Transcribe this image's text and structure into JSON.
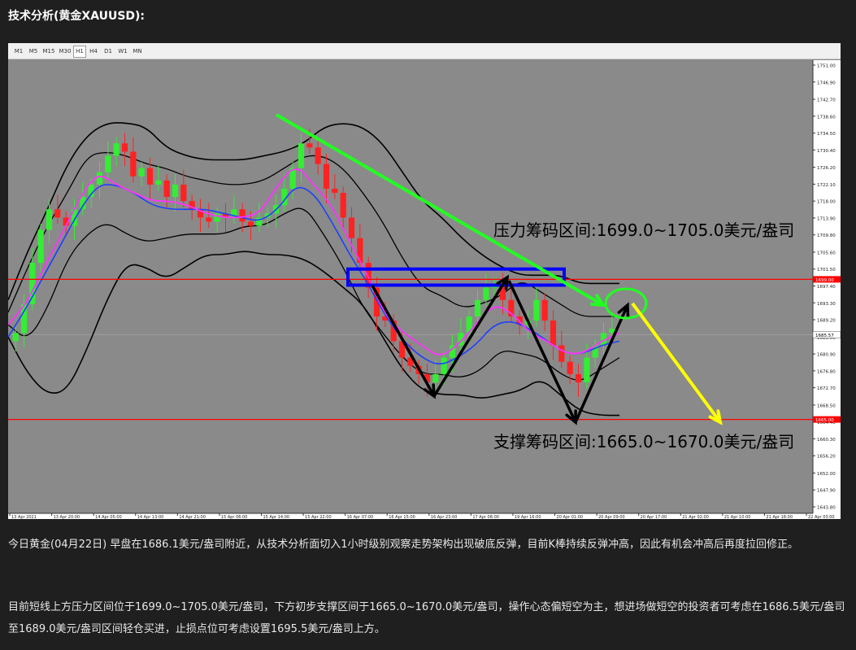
{
  "heading": "技术分析(黄金XAUUSD):",
  "timeframes": [
    "M1",
    "M5",
    "M15",
    "M30",
    "H1",
    "H4",
    "D1",
    "W1",
    "MN"
  ],
  "active_timeframe": "H1",
  "colors": {
    "background": "#1f1f1f",
    "chart_bg": "#8a8a8a",
    "bull_candle": "#33ee33",
    "bear_candle": "#ff2222",
    "ma_pink": "#ff33ff",
    "ma_blue": "#1f3fff",
    "bollinger": "#000000",
    "level_line": "#ff0000",
    "trend_green": "#22ff22",
    "forecast_yellow": "#ffff00",
    "zone_box": "#0000ff"
  },
  "chart_data": {
    "type": "candlestick",
    "symbol": "XAUUSD",
    "timeframe": "H1",
    "y_axis_ticks": [
      "1751.00",
      "1746.90",
      "1742.70",
      "1738.60",
      "1734.50",
      "1730.40",
      "1726.20",
      "1722.10",
      "1718.00",
      "1713.90",
      "1709.80",
      "1705.60",
      "1701.50",
      "1697.40",
      "1693.30",
      "1689.20",
      "1685.00",
      "1680.90",
      "1676.80",
      "1672.70",
      "1668.50",
      "1664.40",
      "1660.30",
      "1656.20",
      "1652.00",
      "1647.90",
      "1643.80"
    ],
    "ylim": [
      1643.8,
      1751.0
    ],
    "x_axis_labels": [
      "13 Apr 2021",
      "13 Apr 20:00",
      "14 Apr 05:00",
      "14 Apr 13:00",
      "14 Apr 21:00",
      "15 Apr 06:00",
      "15 Apr 14:00",
      "15 Apr 22:00",
      "16 Apr 07:00",
      "16 Apr 15:00",
      "16 Apr 23:00",
      "17 Apr 08:00",
      "19 Apr 16:00",
      "20 Apr 01:00",
      "20 Apr 09:00",
      "20 Apr 17:00",
      "21 Apr 02:00",
      "21 Apr 10:00",
      "21 Apr 18:00",
      "22 Apr 03:00"
    ],
    "current_price": "1685.57",
    "resistance_price": "1699.00",
    "support_price": "1665.00",
    "resistance_label": "压力筹码区间:1699.0~1705.0美元/盎司",
    "support_label": "支撑筹码区间:1665.0~1670.0美元/盎司",
    "series": [
      {
        "close": [
          1686,
          1693,
          1703,
          1711,
          1716,
          1714,
          1712,
          1716,
          1719,
          1722,
          1725,
          1729,
          1732,
          1730,
          1724,
          1726,
          1722,
          1723,
          1719,
          1722,
          1718,
          1716,
          1714,
          1713,
          1715,
          1714,
          1716,
          1713,
          1712,
          1714,
          1715,
          1717,
          1721,
          1726,
          1732,
          1731,
          1727,
          1721,
          1720,
          1714,
          1709,
          1703,
          1697,
          1690,
          1689,
          1684,
          1680,
          1678,
          1676,
          1674,
          1676,
          1680,
          1683,
          1686,
          1690,
          1694,
          1697,
          1698,
          1694,
          1690,
          1688,
          1689,
          1694,
          1689,
          1683,
          1679,
          1676,
          1674,
          1680,
          1683,
          1686,
          1687
        ]
      }
    ],
    "bollinger_outer_upper": [
      1694,
      1706,
      1716,
      1727,
      1734,
      1737,
      1737,
      1736,
      1731,
      1729,
      1728,
      1728,
      1728,
      1729,
      1730,
      1732,
      1736,
      1737,
      1736,
      1732,
      1725,
      1718,
      1714,
      1709,
      1705,
      1702,
      1700,
      1700,
      1700,
      1698,
      1698,
      1698
    ],
    "bollinger_outer_lower": [
      1685,
      1676,
      1671,
      1672,
      1682,
      1694,
      1703,
      1702,
      1699,
      1702,
      1705,
      1705,
      1706,
      1705,
      1705,
      1704,
      1701,
      1697,
      1693,
      1685,
      1677,
      1672,
      1671,
      1671,
      1670,
      1671,
      1672,
      1675,
      1671,
      1667,
      1666,
      1666
    ],
    "bollinger_inner_upper": [
      1691,
      1702,
      1712,
      1720,
      1729,
      1730,
      1729,
      1727,
      1726,
      1724,
      1723,
      1722,
      1722,
      1723,
      1726,
      1729,
      1729,
      1726,
      1720,
      1713,
      1704,
      1697,
      1695,
      1692,
      1693,
      1695,
      1699,
      1696,
      1693,
      1690,
      1690,
      1690
    ],
    "bollinger_inner_lower": [
      1688,
      1684,
      1692,
      1704,
      1710,
      1713,
      1710,
      1708,
      1709,
      1710,
      1710,
      1710,
      1712,
      1712,
      1715,
      1717,
      1710,
      1702,
      1692,
      1686,
      1680,
      1676,
      1676,
      1675,
      1677,
      1682,
      1681,
      1680,
      1676,
      1674,
      1677,
      1680
    ],
    "ma_fast": [
      1688,
      1693,
      1702,
      1710,
      1719,
      1725,
      1722,
      1720,
      1718,
      1718,
      1717,
      1715,
      1714,
      1714,
      1715,
      1722,
      1727,
      1722,
      1717,
      1708,
      1700,
      1690,
      1686,
      1683,
      1680,
      1683,
      1688,
      1693,
      1691,
      1686,
      1684,
      1681,
      1681,
      1684,
      1686
    ],
    "ma_slow": [
      1685,
      1692,
      1700,
      1708,
      1716,
      1722,
      1722,
      1720,
      1717,
      1716,
      1716,
      1716,
      1715,
      1714,
      1713,
      1716,
      1722,
      1720,
      1713,
      1705,
      1698,
      1690,
      1684,
      1680,
      1678,
      1680,
      1683,
      1688,
      1689,
      1687,
      1684,
      1681,
      1681,
      1683,
      1684
    ]
  },
  "paragraphs": [
    "今日黄金(04月22日) 早盘在1686.1美元/盎司附近，从技术分析面切入1小时级别观察走势架构出现破底反弹，目前K棒持续反弹冲高，因此有机会冲高后再度拉回修正。",
    "目前短线上方压力区间位于1699.0~1705.0美元/盎司，下方初步支撑区间于1665.0~1670.0美元/盎司，操作心态偏短空为主，想进场做短空的投资者可考虑在1686.5美元/盎司至1689.0美元/盎司区间轻仓买进，止损点位可考虑设置1695.5美元/盎司上方。"
  ]
}
